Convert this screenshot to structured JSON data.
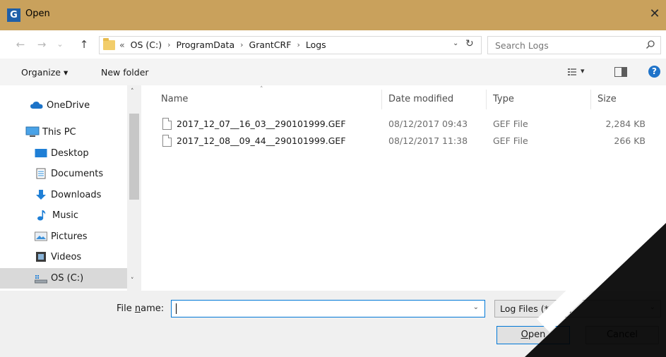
{
  "window": {
    "icon_letter": "G",
    "title": "Open",
    "close_glyph": "✕"
  },
  "nav": {
    "back_glyph": "←",
    "forward_glyph": "→",
    "recent_glyph": "⌄",
    "up_glyph": "↑",
    "breadcrumbs": [
      "«",
      "OS (C:)",
      "ProgramData",
      "GrantCRF",
      "Logs"
    ],
    "crumb_separator": "›",
    "dropdown_glyph": "⌄",
    "refresh_glyph": "↻",
    "search_placeholder": "Search Logs"
  },
  "toolbar": {
    "organize_label": "Organize ▾",
    "new_folder_label": "New folder",
    "view_dropdown_glyph": "▾",
    "help_glyph": "?"
  },
  "sidebar": {
    "items": [
      {
        "label": "OneDrive",
        "icon": "cloud-icon"
      },
      {
        "label": "This PC",
        "icon": "computer-icon"
      },
      {
        "label": "Desktop",
        "icon": "desktop-icon"
      },
      {
        "label": "Documents",
        "icon": "documents-icon"
      },
      {
        "label": "Downloads",
        "icon": "download-icon"
      },
      {
        "label": "Music",
        "icon": "music-icon"
      },
      {
        "label": "Pictures",
        "icon": "pictures-icon"
      },
      {
        "label": "Videos",
        "icon": "videos-icon"
      },
      {
        "label": "OS (C:)",
        "icon": "drive-icon",
        "selected": true
      }
    ],
    "scroll_up_glyph": "˄",
    "scroll_down_glyph": "˅"
  },
  "files": {
    "columns": [
      "Name",
      "Date modified",
      "Type",
      "Size"
    ],
    "sort_indicator": "˄",
    "rows": [
      {
        "name": "2017_12_07__16_03__290101999.GEF",
        "date": "08/12/2017 09:43",
        "type": "GEF File",
        "size": "2,284 KB"
      },
      {
        "name": "2017_12_08__09_44__290101999.GEF",
        "date": "08/12/2017 11:38",
        "type": "GEF File",
        "size": "266 KB"
      }
    ]
  },
  "footer": {
    "file_name_label_prefix": "File ",
    "file_name_label_access": "n",
    "file_name_label_suffix": "ame:",
    "file_name_value": "",
    "dropdown_glyph": "⌄",
    "file_type": "Log Files (*.GEF)",
    "open_access": "O",
    "open_rest": "pen",
    "cancel_label": "Cancel"
  },
  "colors": {
    "titlebar": "#c9a15c",
    "accent": "#0078d7",
    "selected_nav": "#d9d9d9"
  }
}
